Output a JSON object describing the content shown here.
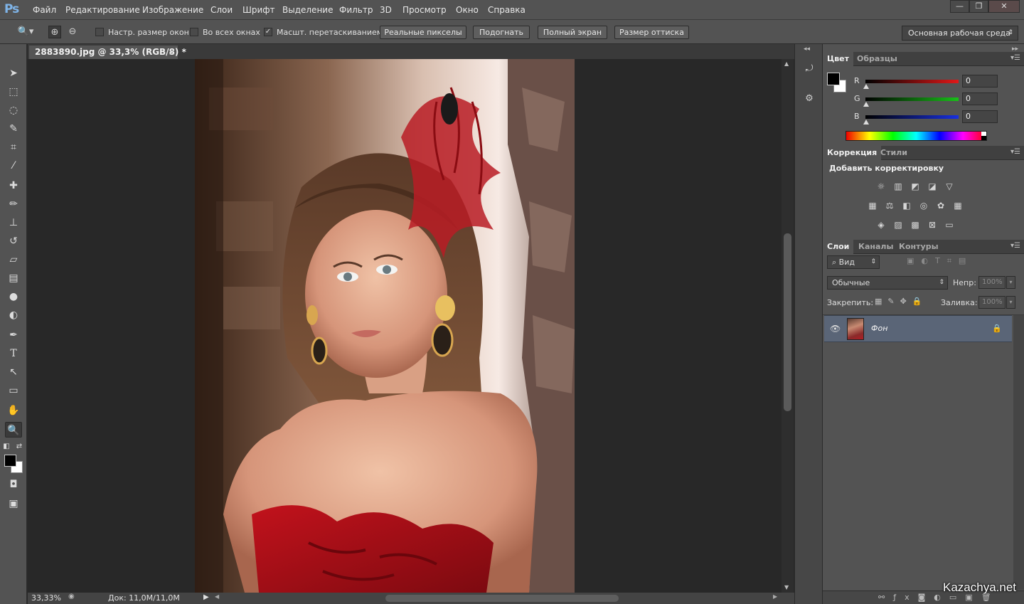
{
  "app": {
    "logo": "Ps",
    "menu": [
      "Файл",
      "Редактирование",
      "Изображение",
      "Слои",
      "Шрифт",
      "Выделение",
      "Фильтр",
      "3D",
      "Просмотр",
      "Окно",
      "Справка"
    ],
    "window_controls": {
      "minimize": "—",
      "restore": "❐",
      "close": "✕"
    }
  },
  "options": {
    "resize_windows_label": "Настр. размер окон",
    "all_windows_label": "Во всех окнах",
    "scrubby_zoom_label": "Масшт. перетаскиванием",
    "scrubby_zoom_checked": true,
    "buttons": [
      "Реальные пикселы",
      "Подогнать",
      "Полный экран",
      "Размер оттиска"
    ],
    "workspace": "Основная рабочая среда"
  },
  "document": {
    "tab_title": "2883890.jpg @ 33,3% (RGB/8) *",
    "close": "×"
  },
  "status": {
    "zoom": "33,33%",
    "doc_size": "Док: 11,0M/11,0M"
  },
  "color_panel": {
    "tabs": [
      "Цвет",
      "Образцы"
    ],
    "channels": [
      {
        "label": "R",
        "value": "0",
        "color": "#e01818"
      },
      {
        "label": "G",
        "value": "0",
        "color": "#18c018"
      },
      {
        "label": "B",
        "value": "0",
        "color": "#1830e0"
      }
    ],
    "foreground": "#000000",
    "background": "#ffffff"
  },
  "adjustments_panel": {
    "tabs": [
      "Коррекция",
      "Стили"
    ],
    "title": "Добавить корректировку"
  },
  "layers_panel": {
    "tabs": [
      "Слои",
      "Каналы",
      "Контуры"
    ],
    "filter": "Вид",
    "blend_mode": "Обычные",
    "opacity_label": "Непр:",
    "opacity_value": "100%",
    "lock_label": "Закрепить:",
    "fill_label": "Заливка:",
    "fill_value": "100%",
    "layers": [
      {
        "name": "Фон",
        "visible": true,
        "locked": true
      }
    ]
  },
  "watermark": "Kazachya.net"
}
